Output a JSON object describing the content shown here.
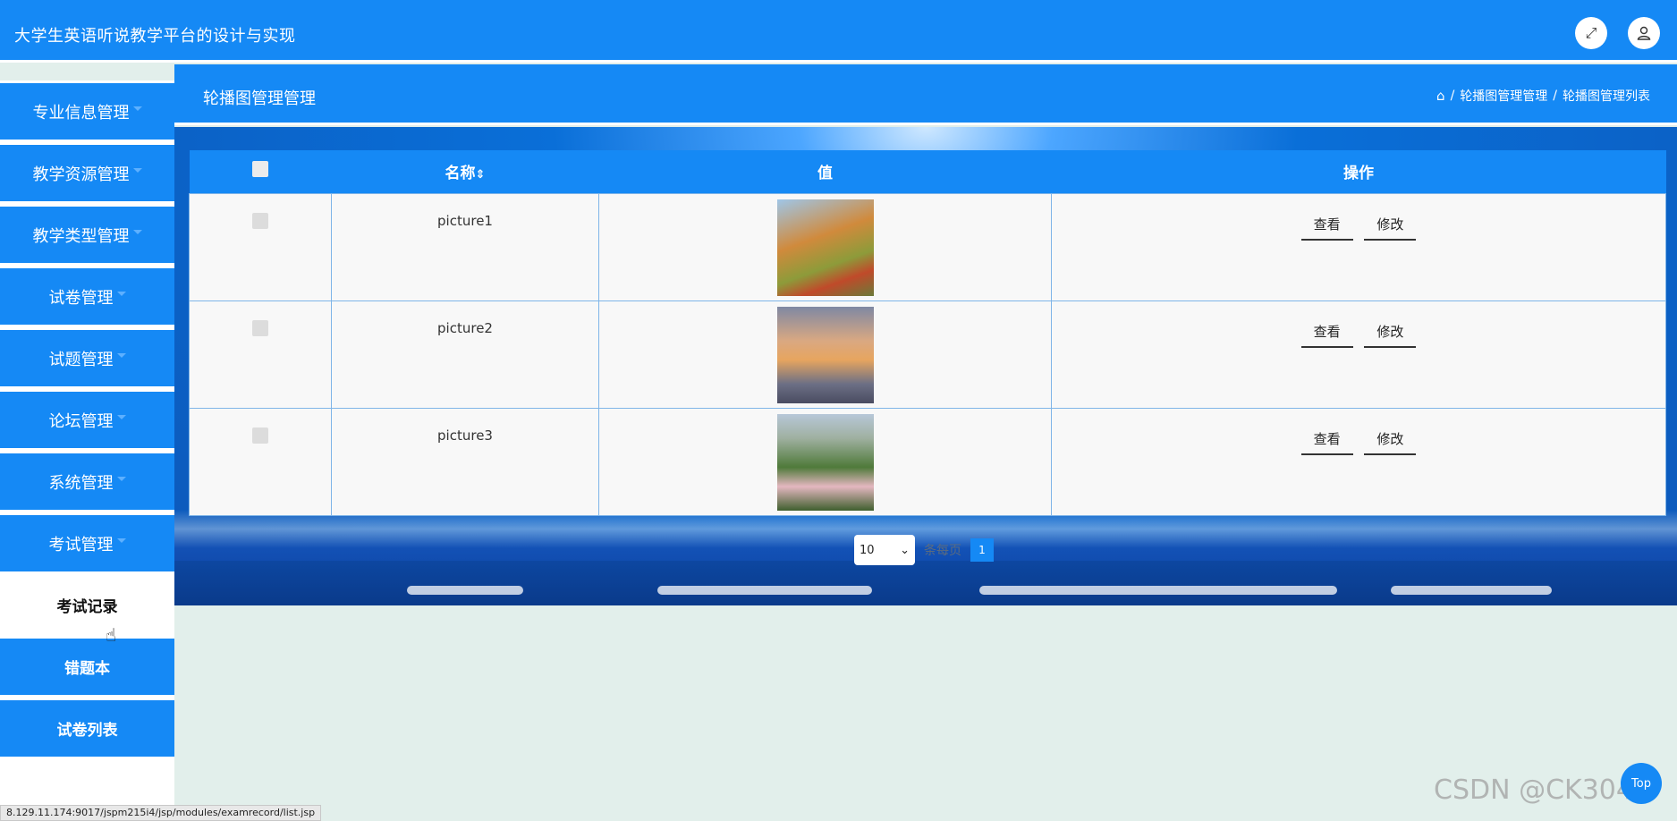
{
  "app_title": "大学生英语听说教学平台的设计与实现",
  "header": {
    "fullscreen_icon": "expand-icon",
    "user_icon": "user-icon"
  },
  "sidebar": {
    "items": [
      {
        "label": "专业信息管理"
      },
      {
        "label": "教学资源管理"
      },
      {
        "label": "教学类型管理"
      },
      {
        "label": "试卷管理"
      },
      {
        "label": "试题管理"
      },
      {
        "label": "论坛管理"
      },
      {
        "label": "系统管理"
      },
      {
        "label": "考试管理"
      }
    ],
    "subitems": [
      {
        "label": "考试记录",
        "active": true
      },
      {
        "label": "错题本"
      },
      {
        "label": "试卷列表"
      }
    ]
  },
  "page": {
    "title": "轮播图管理管理",
    "breadcrumb": [
      "轮播图管理管理",
      "轮播图管理列表"
    ]
  },
  "table": {
    "columns": [
      "名称",
      "值",
      "操作"
    ],
    "sort_icon": "⇕",
    "rows": [
      {
        "name": "picture1",
        "view": "查看",
        "edit": "修改"
      },
      {
        "name": "picture2",
        "view": "查看",
        "edit": "修改"
      },
      {
        "name": "picture3",
        "view": "查看",
        "edit": "修改"
      }
    ]
  },
  "pager": {
    "page_size": "10",
    "per_page_label": "条每页",
    "current_page": "1"
  },
  "status_url": "8.129.11.174:9017/jspm215i4/jsp/modules/examrecord/list.jsp",
  "watermark": "CSDN @CK3040",
  "top_button": "Top"
}
